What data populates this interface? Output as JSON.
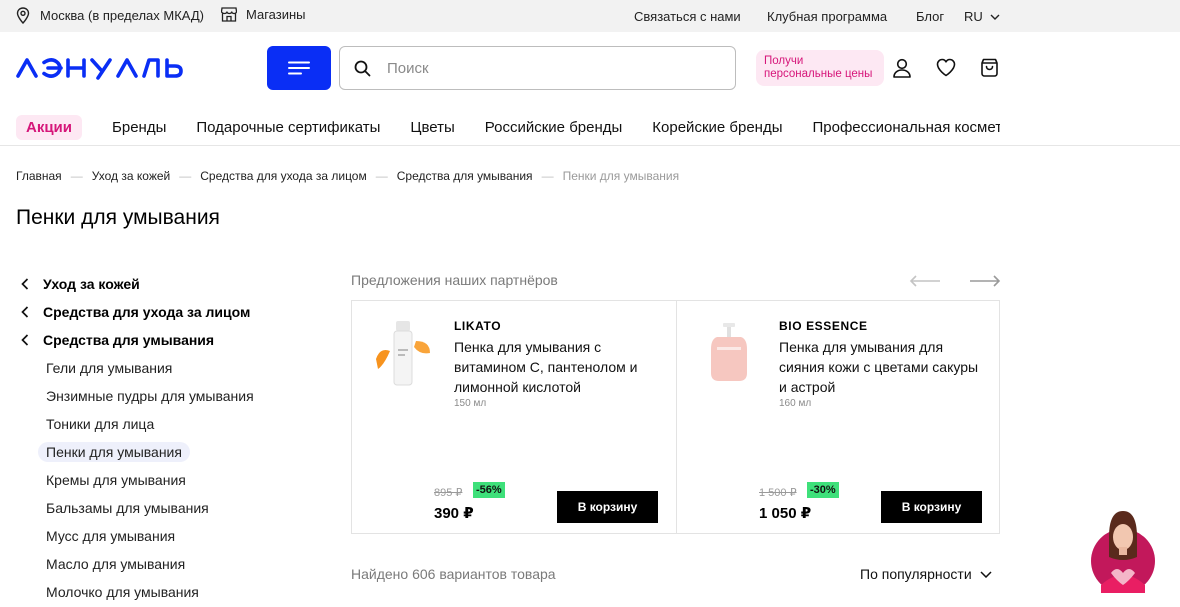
{
  "topbar": {
    "location": "Москва (в пределах МКАД)",
    "stores": "Магазины",
    "contact": "Связаться с нами",
    "club": "Клубная программа",
    "blog": "Блог",
    "lang": "RU"
  },
  "header": {
    "logo_text": "лэтуаль",
    "search_placeholder": "Поиск",
    "promo": "Получи персональные цены"
  },
  "nav": {
    "promo_pill": "Акции",
    "links": [
      "Бренды",
      "Подарочные сертификаты",
      "Цветы",
      "Российские бренды",
      "Корейские бренды",
      "Профессиональная космети"
    ]
  },
  "breadcrumbs": [
    "Главная",
    "Уход за кожей",
    "Средства для ухода за лицом",
    "Средства для умывания",
    "Пенки для умывания"
  ],
  "page_title": "Пенки для умывания",
  "sidebar": {
    "parents": [
      "Уход за кожей",
      "Средства для ухода за лицом",
      "Средства для умывания"
    ],
    "children": [
      "Гели для умывания",
      "Энзимные пудры для умывания",
      "Тоники для лица",
      "Пенки для умывания",
      "Кремы для умывания",
      "Бальзамы для умывания",
      "Мусс для умывания",
      "Масло для умывания",
      "Молочко для умывания"
    ],
    "active_child": "Пенки для умывания"
  },
  "partners": {
    "title": "Предложения наших партнёров",
    "cards": [
      {
        "brand": "LIKATO",
        "name": "Пенка для умывания с витамином С, пантенолом и лимонной кислотой",
        "volume": "150 мл",
        "old_price": "895 ₽",
        "discount": "-56%",
        "price": "390 ₽",
        "button": "В корзину"
      },
      {
        "brand": "BIO ESSENCE",
        "name": "Пенка для умывания для сияния кожи с цветами сакуры и астрой",
        "volume": "160 мл",
        "old_price": "1 500 ₽",
        "discount": "-30%",
        "price": "1 050 ₽",
        "button": "В корзину"
      }
    ]
  },
  "results": {
    "found": "Найдено 606 вариантов товара",
    "sort": "По популярности"
  },
  "colors": {
    "brand_blue": "#0a2ef5",
    "promo_pink": "#d6167a",
    "discount_green": "#3ee07a"
  }
}
